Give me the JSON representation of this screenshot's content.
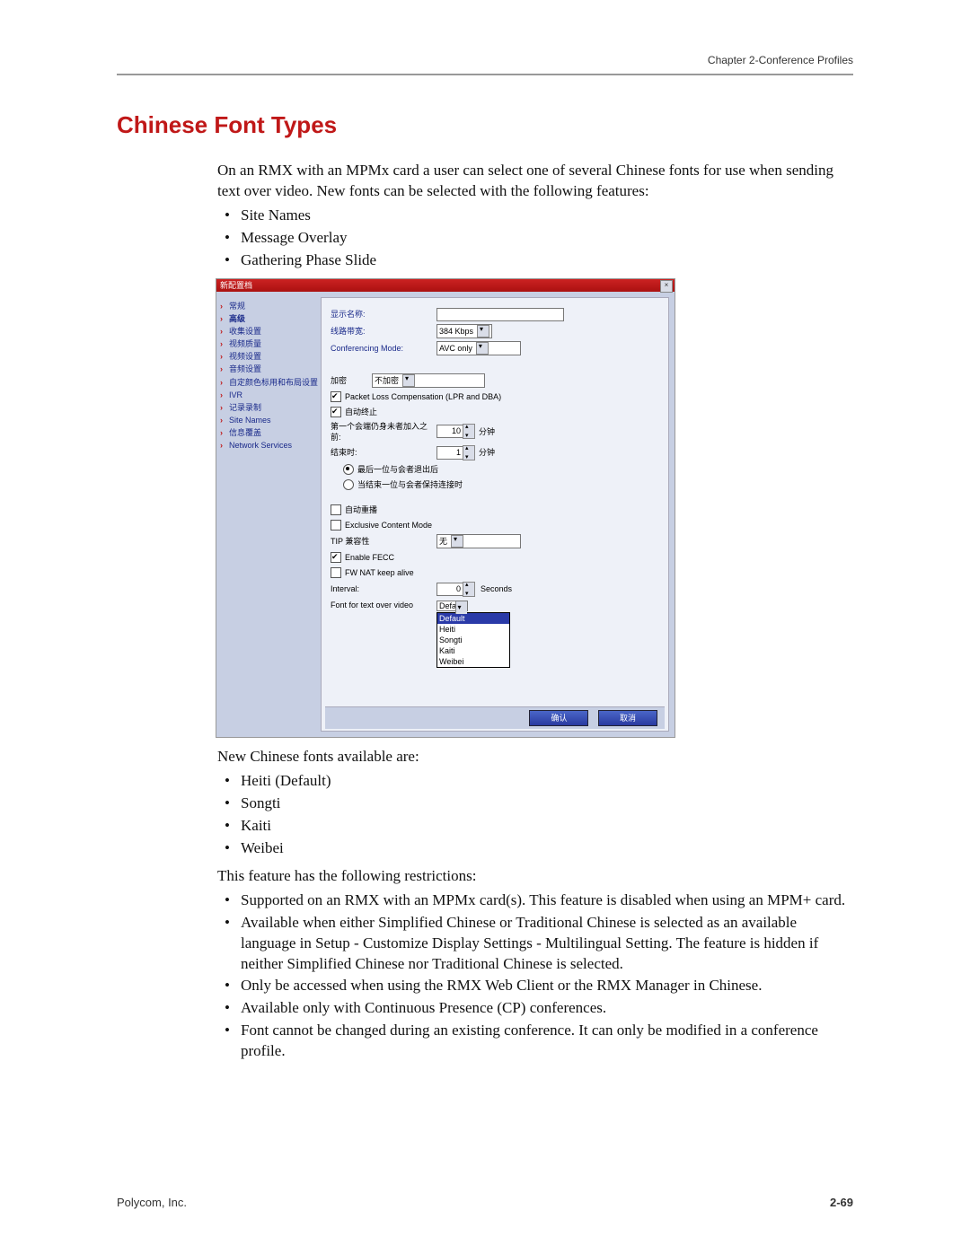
{
  "header": {
    "chapter": "Chapter 2-Conference Profiles"
  },
  "title": "Chinese Font Types",
  "intro": "On an RMX with an MPMx card a user can select one of several Chinese fonts for use when sending text over video. New fonts can be selected with the following features:",
  "features": [
    "Site Names",
    "Message Overlay",
    "Gathering Phase Slide"
  ],
  "shot": {
    "title": "新配置档",
    "nav": [
      {
        "label": "常规",
        "bold": false
      },
      {
        "label": "高级",
        "bold": true
      },
      {
        "label": "收集设置",
        "bold": false
      },
      {
        "label": "视频质量",
        "bold": false
      },
      {
        "label": "视频设置",
        "bold": false
      },
      {
        "label": "音频设置",
        "bold": false
      },
      {
        "label": "自定颜色标用和布局设置",
        "bold": false
      },
      {
        "label": "IVR",
        "bold": false
      },
      {
        "label": "记录录制",
        "bold": false
      },
      {
        "label": "Site Names",
        "bold": false
      },
      {
        "label": "信息覆盖",
        "bold": false
      },
      {
        "label": "Network Services",
        "bold": false
      }
    ],
    "labels": {
      "displayName": "显示名称:",
      "lineRate": "线路带宽:",
      "confMode": "Conferencing Mode:",
      "encryption": "加密",
      "lpr": "Packet Loss Compensation (LPR and DBA)",
      "autoEnd": "自动终止",
      "beforeJoin": "第一个会端仍身未者加入之前:",
      "atEnd": "结束时:",
      "radio1": "最后一位与会者退出后",
      "radio2": "当结束一位与会者保持连接时",
      "autoLayout": "自动重播",
      "exclusive": "Exclusive Content Mode",
      "tipCompat": "TIP 兼容性",
      "enableFecc": "Enable FECC",
      "fwNat": "FW NAT keep alive",
      "interval": "Interval:",
      "seconds": "Seconds",
      "fontLabel": "Font for text over video",
      "minutes": "分钟"
    },
    "values": {
      "lineRate": "384 Kbps",
      "confMode": "AVC only",
      "encryption": "不加密",
      "beforeJoin": "10",
      "atEnd": "1",
      "tipCompat": "无",
      "interval": "0",
      "fontSelected": "Default"
    },
    "fontOptions": [
      "Default",
      "Heiti",
      "Songti",
      "Kaiti",
      "Weibei"
    ],
    "buttons": {
      "ok": "确认",
      "cancel": "取消"
    }
  },
  "afterShotIntro": "New Chinese fonts available are:",
  "fonts": [
    "Heiti (Default)",
    "Songti",
    "Kaiti",
    "Weibei"
  ],
  "restrictionsIntro": "This feature has the following restrictions:",
  "restrictions": [
    "Supported on an RMX with an MPMx card(s). This feature is disabled when using an MPM+ card.",
    "Available when either Simplified Chinese or Traditional Chinese is selected as an available language in Setup - Customize Display Settings - Multilingual Setting. The feature is hidden if neither Simplified Chinese nor Traditional Chinese is selected.",
    "Only be accessed when using the RMX Web Client or the RMX Manager in Chinese.",
    "Available only with Continuous Presence (CP) conferences.",
    "Font cannot be changed during an existing conference. It can only be modified in a conference profile."
  ],
  "footer": {
    "left": "Polycom, Inc.",
    "right": "2-69"
  }
}
